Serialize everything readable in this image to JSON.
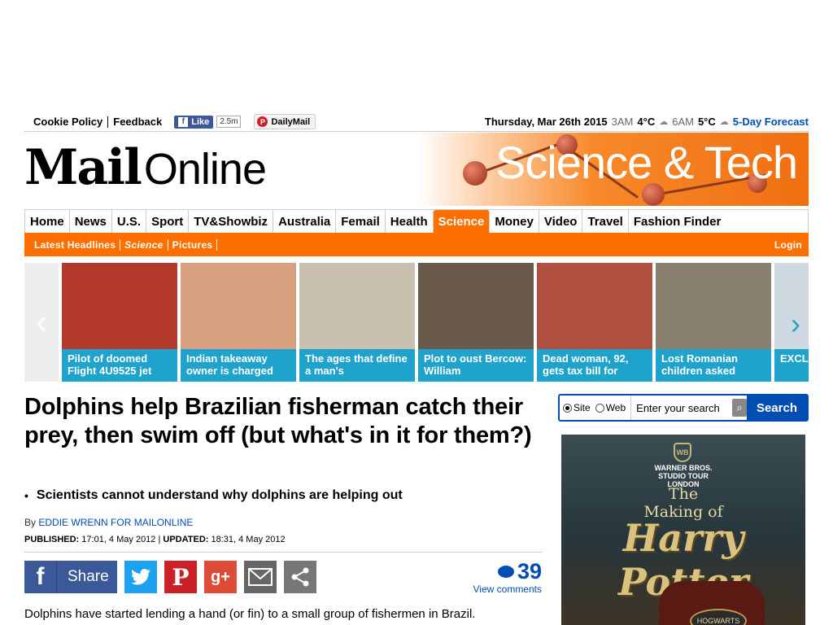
{
  "topbar": {
    "cookie_policy": "Cookie Policy",
    "feedback": "Feedback",
    "fb_like": "Like",
    "fb_count": "2.5m",
    "pinterest": "DailyMail",
    "date": "Thursday, Mar 26th 2015",
    "time1": "3AM",
    "temp1": "4°C",
    "time2": "6AM",
    "temp2": "5°C",
    "forecast": "5-Day Forecast"
  },
  "masthead": {
    "logo_mail": "Mail",
    "logo_online": "Online",
    "section_banner": "Science & Tech"
  },
  "nav": {
    "items": [
      "Home",
      "News",
      "U.S.",
      "Sport",
      "TV&Showbiz",
      "Australia",
      "Femail",
      "Health",
      "Science",
      "Money",
      "Video",
      "Travel",
      "Fashion Finder"
    ],
    "active": "Science"
  },
  "subnav": {
    "items": [
      "Latest Headlines",
      "Science",
      "Pictures"
    ],
    "login": "Login"
  },
  "carousel": {
    "cards": [
      {
        "caption": "Pilot of doomed Flight 4U9525 jet",
        "color": "#b33a2a"
      },
      {
        "caption": "Indian takeaway owner is charged",
        "color": "#d7a07e"
      },
      {
        "caption": "The ages that define a man's",
        "color": "#c9c0b0"
      },
      {
        "caption": "Plot to oust Bercow: William",
        "color": "#6a5a4c"
      },
      {
        "caption": "Dead woman, 92, gets tax bill for",
        "color": "#b05040"
      },
      {
        "caption": "Lost Romanian children asked",
        "color": "#8a8070"
      },
      {
        "caption": "EXCL Malik",
        "color": "#cdd8e0"
      }
    ]
  },
  "article": {
    "headline": "Dolphins help Brazilian fisherman catch their prey, then swim off (but what's in it for them?)",
    "bullet": "Scientists cannot understand why dolphins are helping out",
    "by": "By",
    "author": "EDDIE WRENN FOR MAILONLINE",
    "published_label": "PUBLISHED:",
    "published": "17:01, 4 May 2012",
    "updated_label": "UPDATED:",
    "updated": "18:31, 4 May 2012",
    "share_label": "Share",
    "comment_count": "39",
    "view_comments": "View comments",
    "body_first": "Dolphins have started lending a hand (or fin) to a small group of fishermen in Brazil."
  },
  "search": {
    "opt_site": "Site",
    "opt_web": "Web",
    "placeholder": "Enter your search",
    "button": "Search"
  },
  "ad": {
    "studio_line1": "WARNER BROS.",
    "studio_line2": "STUDIO TOUR",
    "studio_line3": "LONDON",
    "making_line1": "The",
    "making_line2": "Making of",
    "title": "Harry Potter",
    "plate": "HOGWARTS"
  },
  "colors": {
    "brand_orange": "#ff6f00",
    "link_blue": "#004db3",
    "carousel_blue": "#1fa3cc",
    "facebook": "#3b5998"
  }
}
